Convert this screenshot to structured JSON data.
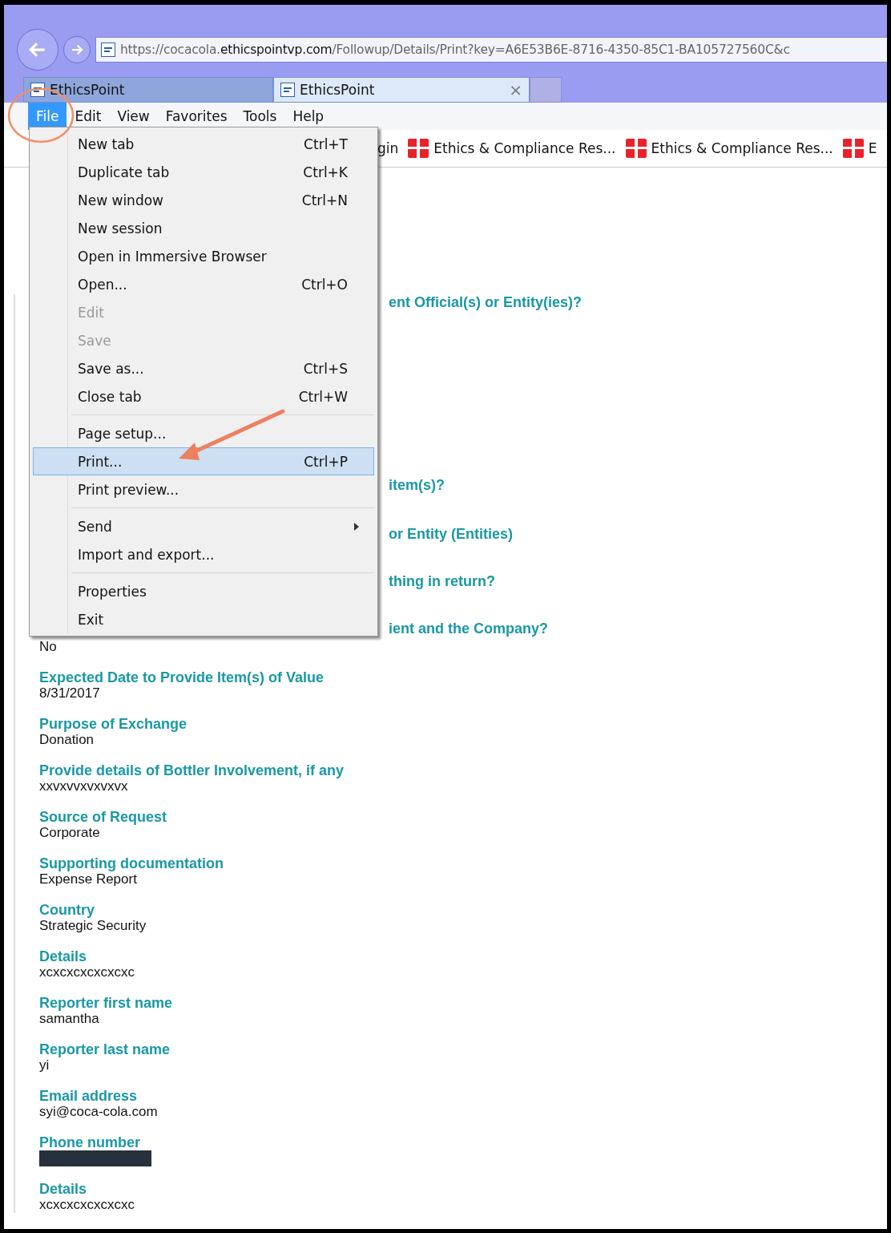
{
  "address_bar": {
    "url_prefix": "https://cocacola.",
    "url_domain": "ethicspointvp.com",
    "url_path": "/Followup/Details/Print?key=A6E53B6E-8716-4350-85C1-BA105727560C&c"
  },
  "tabs": [
    {
      "label": "EthicsPoint",
      "selected": false
    },
    {
      "label": "EthicsPoint",
      "selected": true,
      "close": "×"
    }
  ],
  "menu_bar": [
    {
      "label": "File",
      "selected": true
    },
    {
      "label": "Edit",
      "selected": false
    },
    {
      "label": "View",
      "selected": false
    },
    {
      "label": "Favorites",
      "selected": false
    },
    {
      "label": "Tools",
      "selected": false
    },
    {
      "label": "Help",
      "selected": false
    }
  ],
  "favorites": [
    {
      "label": "gin",
      "kind": "text"
    },
    {
      "label": "Ethics & Compliance Res...",
      "kind": "site"
    },
    {
      "label": "Ethics & Compliance Res...",
      "kind": "site"
    },
    {
      "label": "E",
      "kind": "site"
    }
  ],
  "file_menu": [
    {
      "kind": "item",
      "label": "New tab",
      "shortcut": "Ctrl+T",
      "disabled": false,
      "selected": false
    },
    {
      "kind": "item",
      "label": "Duplicate tab",
      "shortcut": "Ctrl+K",
      "disabled": false,
      "selected": false
    },
    {
      "kind": "item",
      "label": "New window",
      "shortcut": "Ctrl+N",
      "disabled": false,
      "selected": false
    },
    {
      "kind": "item",
      "label": "New session",
      "disabled": false,
      "selected": false
    },
    {
      "kind": "item",
      "label": "Open in Immersive Browser",
      "disabled": false,
      "selected": false
    },
    {
      "kind": "item",
      "label": "Open...",
      "shortcut": "Ctrl+O",
      "disabled": false,
      "selected": false
    },
    {
      "kind": "item",
      "label": "Edit",
      "disabled": true,
      "selected": false
    },
    {
      "kind": "item",
      "label": "Save",
      "disabled": true,
      "selected": false
    },
    {
      "kind": "item",
      "label": "Save as...",
      "shortcut": "Ctrl+S",
      "disabled": false,
      "selected": false
    },
    {
      "kind": "item",
      "label": "Close tab",
      "shortcut": "Ctrl+W",
      "disabled": false,
      "selected": false
    },
    {
      "kind": "separator"
    },
    {
      "kind": "item",
      "label": "Page setup...",
      "disabled": false,
      "selected": false
    },
    {
      "kind": "item",
      "label": "Print...",
      "shortcut": "Ctrl+P",
      "disabled": false,
      "selected": true
    },
    {
      "kind": "item",
      "label": "Print preview...",
      "disabled": false,
      "selected": false
    },
    {
      "kind": "separator"
    },
    {
      "kind": "submenu",
      "label": "Send",
      "disabled": false,
      "selected": false
    },
    {
      "kind": "item",
      "label": "Import and export...",
      "disabled": false,
      "selected": false
    },
    {
      "kind": "separator"
    },
    {
      "kind": "item",
      "label": "Properties",
      "disabled": false,
      "selected": false
    },
    {
      "kind": "item",
      "label": "Exit",
      "disabled": false,
      "selected": false
    }
  ],
  "partial_headings": [
    "ent Official(s) or Entity(ies)?",
    "item(s)?",
    "or Entity (Entities)",
    "thing in return?",
    "ient and the Company?"
  ],
  "first_value": "No",
  "fields": [
    {
      "label": "Expected Date to Provide Item(s) of Value",
      "value": "8/31/2017"
    },
    {
      "label": "Purpose of Exchange",
      "value": "Donation"
    },
    {
      "label": "Provide details of Bottler Involvement, if any",
      "value": "xxvxvvxvxvxvx"
    },
    {
      "label": "Source of Request",
      "value": "Corporate"
    },
    {
      "label": "Supporting documentation",
      "value": "Expense Report"
    },
    {
      "label": "Country",
      "value": "Strategic Security"
    },
    {
      "label": "Details",
      "value": "xcxcxcxcxcxcxc"
    },
    {
      "label": "Reporter first name",
      "value": "samantha"
    },
    {
      "label": "Reporter last name",
      "value": "yi"
    },
    {
      "label": "Email address",
      "value": "syi@coca-cola.com"
    },
    {
      "label": "Phone number",
      "kind": "redacted"
    },
    {
      "label": "Details",
      "value": "xcxcxcxcxcxcxc"
    }
  ]
}
